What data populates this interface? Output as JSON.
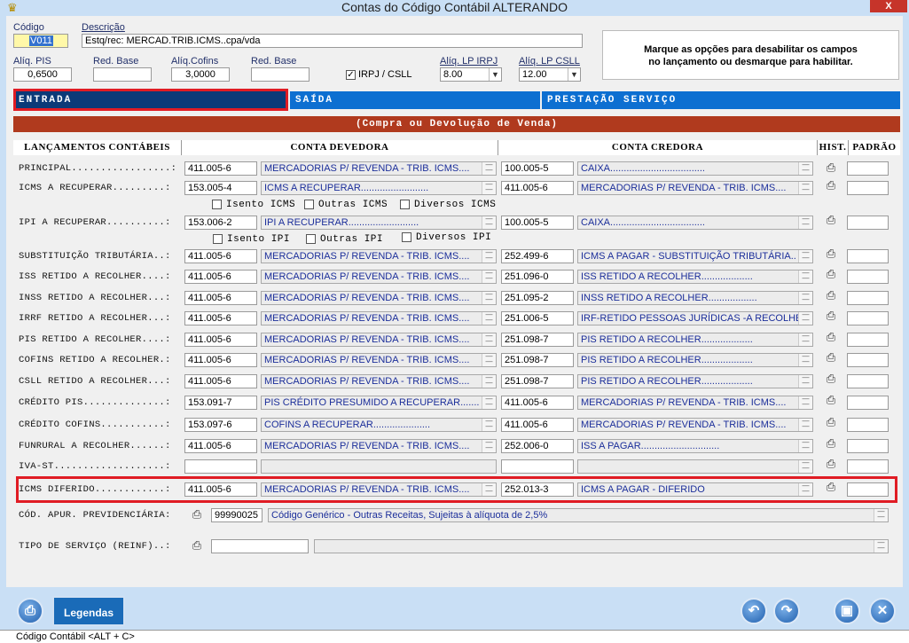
{
  "window": {
    "title": "Contas do Código Contábil    ALTERANDO",
    "close": "X"
  },
  "header": {
    "codigo_label": "Código",
    "codigo_value": "V011",
    "descricao_label": "Descrição",
    "descricao_value": "Estq/rec: MERCAD.TRIB.ICMS..cpa/vda",
    "aliq_pis_label": "Alíq. PIS",
    "aliq_pis_value": "0,6500",
    "red_base1_label": "Red. Base",
    "red_base1_value": "",
    "aliq_cofins_label": "Alíq.Cofins",
    "aliq_cofins_value": "3,0000",
    "red_base2_label": "Red. Base",
    "red_base2_value": "",
    "irpj_label": "IRPJ / CSLL",
    "irpj_checked": "✓",
    "aliq_lp_irpj_label": "Alíq. LP IRPJ",
    "aliq_lp_irpj_value": "8.00",
    "aliq_lp_csll_label": "Alíq. LP CSLL",
    "aliq_lp_csll_value": "12.00",
    "info_line1": "Marque as opções para desabilitar os campos",
    "info_line2": "no lançamento ou desmarque para habilitar."
  },
  "tabs": [
    {
      "label": "ENTRADA",
      "color": "#0b3a78"
    },
    {
      "label": "SAÍDA",
      "color": "#0d6fd1"
    },
    {
      "label": "PRESTAÇÃO SERVIÇO",
      "color": "#0d6fd1"
    }
  ],
  "subheader": "(Compra ou Devolução de Venda)",
  "columns": {
    "lanc": "LANÇAMENTOS CONTÁBEIS",
    "devedora": "CONTA DEVEDORA",
    "credora": "CONTA CREDORA",
    "hist": "HIST.",
    "padrao": "PADRÃO"
  },
  "rows": [
    {
      "label": "PRINCIPAL.................:",
      "deb": "411.005-6",
      "deb_desc": "MERCADORIAS P/ REVENDA - TRIB. ICMS....",
      "cred": "100.005-5",
      "cred_desc": "CAIXA..................................."
    },
    {
      "label": "ICMS A RECUPERAR.........:",
      "deb": "153.005-4",
      "deb_desc": "ICMS A RECUPERAR.........................",
      "cred": "411.005-6",
      "cred_desc": "MERCADORIAS P/ REVENDA - TRIB. ICMS...."
    },
    {
      "label": "IPI A RECUPERAR..........:",
      "deb": "153.006-2",
      "deb_desc": "IPI A RECUPERAR..........................",
      "cred": "100.005-5",
      "cred_desc": "CAIXA..................................."
    },
    {
      "label": "SUBSTITUIÇÃO TRIBUTÁRIA..:",
      "deb": "411.005-6",
      "deb_desc": "MERCADORIAS P/ REVENDA - TRIB. ICMS....",
      "cred": "252.499-6",
      "cred_desc": "ICMS A PAGAR - SUBSTITUIÇÃO TRIBUTÁRIA.."
    },
    {
      "label": "ISS RETIDO A RECOLHER....:",
      "deb": "411.005-6",
      "deb_desc": "MERCADORIAS P/ REVENDA - TRIB. ICMS....",
      "cred": "251.096-0",
      "cred_desc": "ISS RETIDO A RECOLHER..................."
    },
    {
      "label": "INSS RETIDO A RECOLHER...:",
      "deb": "411.005-6",
      "deb_desc": "MERCADORIAS P/ REVENDA - TRIB. ICMS....",
      "cred": "251.095-2",
      "cred_desc": "INSS RETIDO A RECOLHER.................."
    },
    {
      "label": "IRRF RETIDO A RECOLHER...:",
      "deb": "411.005-6",
      "deb_desc": "MERCADORIAS P/ REVENDA - TRIB. ICMS....",
      "cred": "251.006-5",
      "cred_desc": "IRF-RETIDO PESSOAS JURÍDICAS -A RECOLHER"
    },
    {
      "label": "PIS RETIDO A RECOLHER....:",
      "deb": "411.005-6",
      "deb_desc": "MERCADORIAS P/ REVENDA - TRIB. ICMS....",
      "cred": "251.098-7",
      "cred_desc": "PIS RETIDO A RECOLHER..................."
    },
    {
      "label": "COFINS RETIDO A RECOLHER.:",
      "deb": "411.005-6",
      "deb_desc": "MERCADORIAS P/ REVENDA - TRIB. ICMS....",
      "cred": "251.098-7",
      "cred_desc": "PIS RETIDO A RECOLHER..................."
    },
    {
      "label": "CSLL RETIDO A RECOLHER...:",
      "deb": "411.005-6",
      "deb_desc": "MERCADORIAS P/ REVENDA - TRIB. ICMS....",
      "cred": "251.098-7",
      "cred_desc": "PIS RETIDO A RECOLHER..................."
    },
    {
      "label": "CRÉDITO PIS..............:",
      "deb": "153.091-7",
      "deb_desc": "PIS CRÉDITO PRESUMIDO A RECUPERAR.......",
      "cred": "411.005-6",
      "cred_desc": "MERCADORIAS P/ REVENDA - TRIB. ICMS...."
    },
    {
      "label": "CRÉDITO COFINS...........:",
      "deb": "153.097-6",
      "deb_desc": "COFINS A RECUPERAR.....................",
      "cred": "411.005-6",
      "cred_desc": "MERCADORIAS P/ REVENDA - TRIB. ICMS...."
    },
    {
      "label": "FUNRURAL A RECOLHER......:",
      "deb": "411.005-6",
      "deb_desc": "MERCADORIAS P/ REVENDA - TRIB. ICMS....",
      "cred": "252.006-0",
      "cred_desc": "ISS A PAGAR............................."
    },
    {
      "label": "IVA-ST...................:",
      "deb": "",
      "deb_desc": "",
      "cred": "",
      "cred_desc": ""
    },
    {
      "label": "ICMS DIFERIDO............:",
      "deb": "411.005-6",
      "deb_desc": "MERCADORIAS P/ REVENDA - TRIB. ICMS....",
      "cred": "252.013-3",
      "cred_desc": "ICMS A PAGAR - DIFERIDO"
    }
  ],
  "icms_checks": {
    "isento": "Isento ICMS",
    "outras": "Outras ICMS",
    "diversos": "Diversos ICMS"
  },
  "ipi_checks": {
    "isento": "Isento IPI",
    "outras": "Outras IPI",
    "diversos": "Diversos IPI"
  },
  "apur": {
    "label": "CÓD. APUR. PREVIDENCIÁRIA:",
    "code": "99990025",
    "desc": "Código Genérico - Outras Receitas, Sujeitas à alíquota de 2,5%"
  },
  "reinf": {
    "label": "TIPO DE SERVIÇO (REINF)..:",
    "code": "",
    "desc": ""
  },
  "bottom": {
    "legendas": "Legendas"
  },
  "status": "Código Contábil  <ALT + C>"
}
